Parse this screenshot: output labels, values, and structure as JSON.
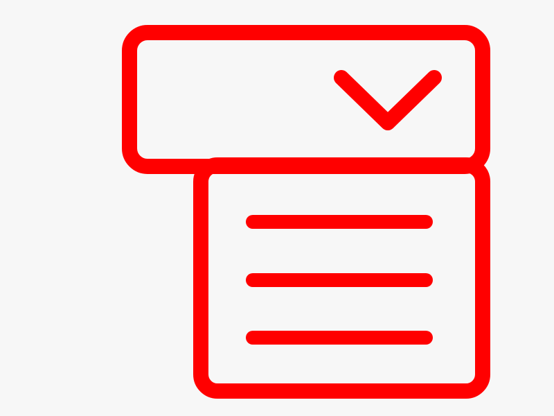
{
  "icon": {
    "name": "dropdown-list-icon",
    "stroke_color": "#ff0000",
    "background_color": "#f7f7f7"
  }
}
